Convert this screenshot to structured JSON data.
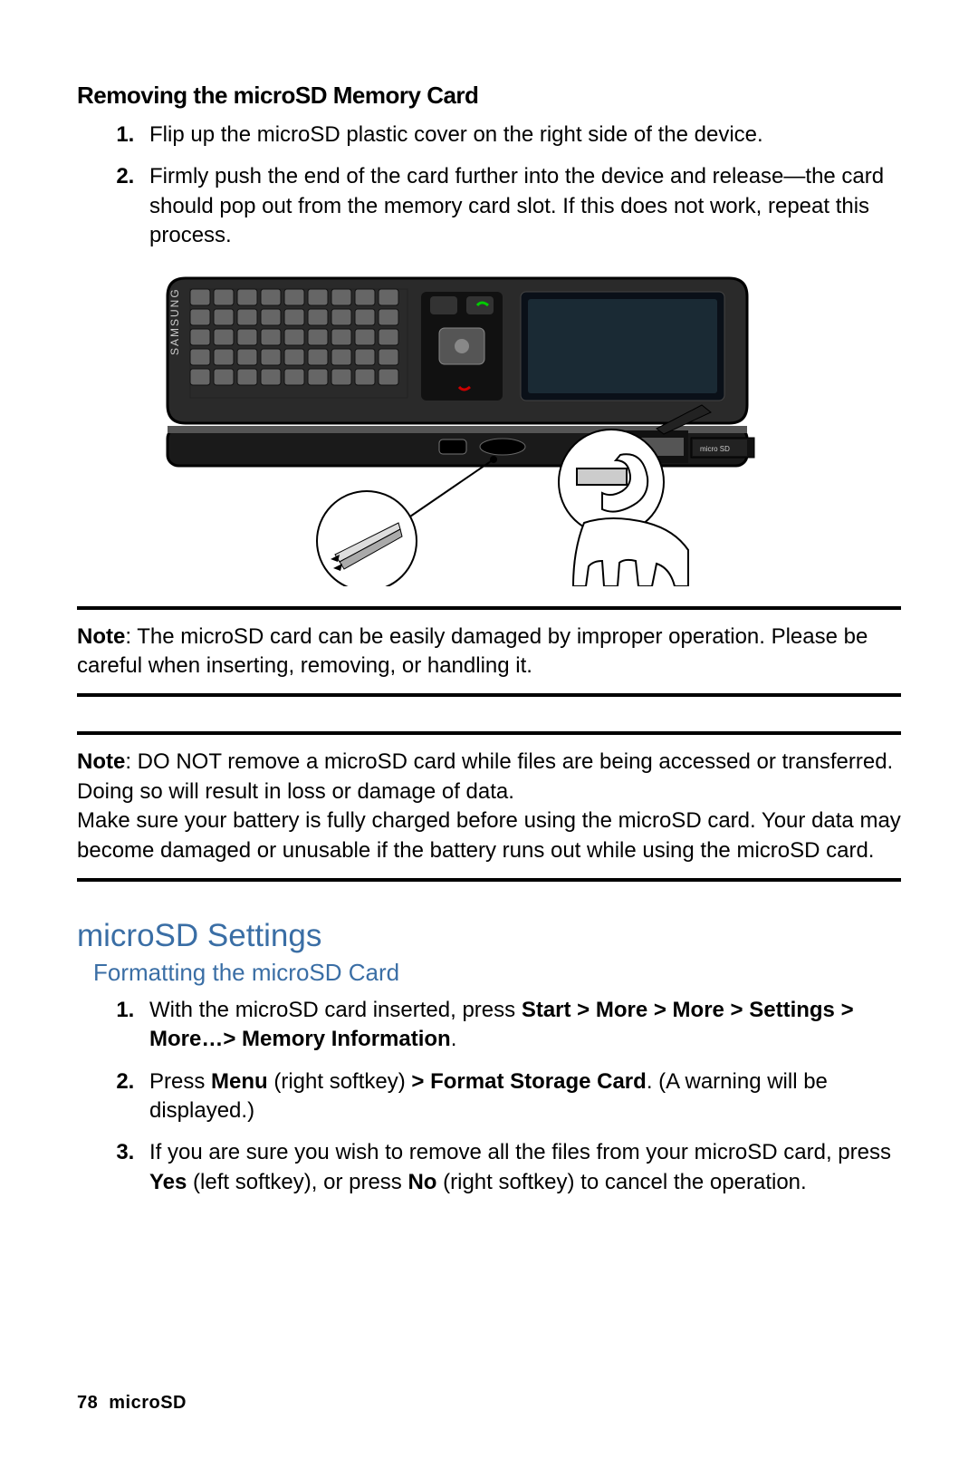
{
  "remove": {
    "heading": "Removing the microSD Memory Card",
    "steps": [
      "Flip up the microSD plastic cover on the right side of the device.",
      "Firmly push the end of the card further into the device and release—the card should pop out from the memory card slot. If this does not work, repeat this process."
    ]
  },
  "note1": {
    "label": "Note",
    "text": ": The microSD card can be easily damaged by improper operation. Please be careful when inserting, removing, or handling it."
  },
  "note2": {
    "label": "Note",
    "text1": ": DO NOT remove a microSD card while files are being accessed or transferred. Doing so will result in loss or damage of data.",
    "text2": "Make sure your battery is fully charged before using the microSD card. Your data may become damaged or unusable if the battery runs out while using the microSD card."
  },
  "settings": {
    "title": "microSD Settings",
    "subtitle": "Formatting the microSD Card",
    "steps": {
      "s1_a": "With the microSD card inserted, press ",
      "s1_b": "Start > More > More > Settings > More…> Memory Information",
      "s1_c": ".",
      "s2_a": "Press ",
      "s2_b": "Menu",
      "s2_c": " (right softkey) ",
      "s2_d": "> Format Storage Card",
      "s2_e": ". (A warning will be displayed.)",
      "s3_a": "If you are sure you wish to remove all the files from your microSD card, press ",
      "s3_b": "Yes",
      "s3_c": " (left softkey), or press ",
      "s3_d": "No",
      "s3_e": " (right softkey) to cancel the operation."
    }
  },
  "footer": {
    "page": "78",
    "section": "microSD"
  }
}
